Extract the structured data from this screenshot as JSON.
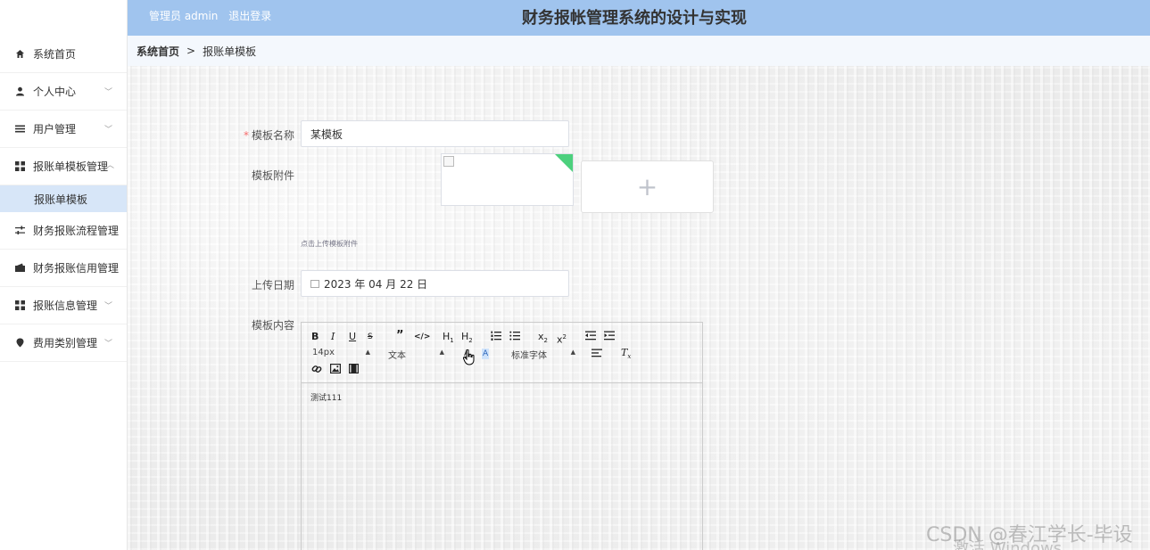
{
  "header": {
    "admin_text": "管理员 admin",
    "logout": "退出登录",
    "title": "财务报帐管理系统的设计与实现"
  },
  "sidebar": {
    "items": [
      {
        "label": "系统首页",
        "icon": "home-icon"
      },
      {
        "label": "个人中心",
        "icon": "user-icon"
      },
      {
        "label": "用户管理",
        "icon": "list-icon"
      },
      {
        "label": "报账单模板管理",
        "icon": "grid-icon"
      },
      {
        "label": "财务报账流程管理",
        "icon": "sliders-icon"
      },
      {
        "label": "财务报账信用管理",
        "icon": "wallet-icon"
      },
      {
        "label": "报账信息管理",
        "icon": "grid-icon"
      },
      {
        "label": "费用类别管理",
        "icon": "map-pin-icon"
      }
    ],
    "submenu": {
      "label": "报账单模板"
    }
  },
  "breadcrumb": {
    "home": "系统首页",
    "separator": ">",
    "current": "报账单模板"
  },
  "form": {
    "name_label": "模板名称",
    "name_value": "某模板",
    "attach_label": "模板附件",
    "upload_tip": "点击上传模板附件",
    "date_label": "上传日期",
    "date_value": "2023 年 04 月 22 日",
    "content_label": "模板内容"
  },
  "editor": {
    "font_size": "14px",
    "block_format": "文本",
    "font_family": "标准字体",
    "content": "测试111"
  },
  "watermark": {
    "csdn": "CSDN @春江学长-毕设",
    "windows": "激活 Windows"
  },
  "colors": {
    "header_bg": "#a0c4ee",
    "submenu_active_bg": "#d7e6f8",
    "required": "#f56c6c",
    "upload_corner": "#4cd07d"
  }
}
